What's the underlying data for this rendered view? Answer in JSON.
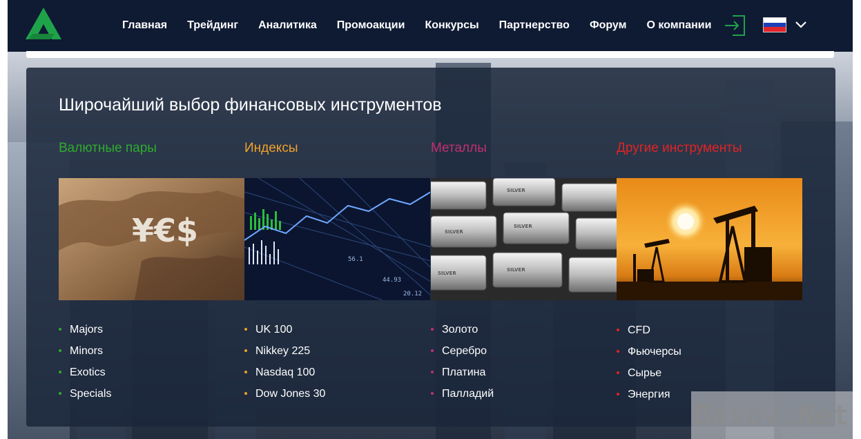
{
  "brand": {
    "logo_icon": "brand-logo-triangle",
    "color": "#1fa34a"
  },
  "nav": {
    "items": [
      {
        "label": "Главная"
      },
      {
        "label": "Трейдинг"
      },
      {
        "label": "Аналитика"
      },
      {
        "label": "Промоакции"
      },
      {
        "label": "Конкурсы"
      },
      {
        "label": "Партнерство"
      },
      {
        "label": "Форум"
      },
      {
        "label": "О компании"
      }
    ],
    "login_icon": "login-arrow-icon",
    "language_icon": "russian-flag-icon",
    "language_dropdown_icon": "chevron-down-icon"
  },
  "main": {
    "title": "Широчайший выбор финансовых инструментов",
    "columns": [
      {
        "title": "Валютные пары",
        "accent": "#2eac2e",
        "image": "currency-symbols-image",
        "items": [
          "Majors",
          "Minors",
          "Exotics",
          "Specials"
        ]
      },
      {
        "title": "Индексы",
        "accent": "#f0a22b",
        "image": "stock-index-chart-image",
        "items": [
          "UK 100",
          "Nikkey 225",
          "Nasdaq 100",
          "Dow Jones 30"
        ]
      },
      {
        "title": "Металлы",
        "accent": "#c1306f",
        "image": "silver-bars-image",
        "items": [
          "Золото",
          "Серебро",
          "Платина",
          "Палладий"
        ]
      },
      {
        "title": "Другие инструменты",
        "accent": "#e02424",
        "image": "oil-pumps-sunset-image",
        "items": [
          "CFD",
          "Фьючерсы",
          "Сырье",
          "Энергия"
        ]
      }
    ]
  },
  "watermark": {
    "text": "Baxov.Net"
  }
}
